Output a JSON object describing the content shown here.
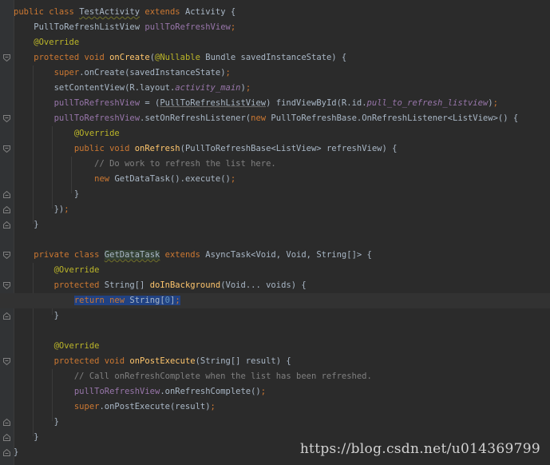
{
  "editor": {
    "language": "java",
    "current_line": 20
  },
  "lines": [
    {
      "line": 1,
      "segments": [
        {
          "t": "public class ",
          "c": "kw"
        },
        {
          "t": "TestActivity",
          "c": "plain warn"
        },
        {
          "t": " extends ",
          "c": "kw"
        },
        {
          "t": "Activity {",
          "c": "plain"
        }
      ]
    },
    {
      "line": 2,
      "segments": [
        {
          "t": "    PullToRefreshListView ",
          "c": "plain"
        },
        {
          "t": "pullToRefreshView",
          "c": "field"
        },
        {
          "t": ";",
          "c": "kw"
        }
      ]
    },
    {
      "line": 3,
      "segments": [
        {
          "t": "    @Override",
          "c": "ann"
        }
      ]
    },
    {
      "line": 4,
      "segments": [
        {
          "t": "    protected void ",
          "c": "kw"
        },
        {
          "t": "onCreate",
          "c": "fn"
        },
        {
          "t": "(",
          "c": "plain"
        },
        {
          "t": "@Nullable",
          "c": "ann"
        },
        {
          "t": " Bundle savedInstanceState) {",
          "c": "plain"
        }
      ]
    },
    {
      "line": 5,
      "segments": [
        {
          "t": "        ",
          "c": "plain"
        },
        {
          "t": "super",
          "c": "kw"
        },
        {
          "t": ".onCreate(savedInstanceState)",
          "c": "plain"
        },
        {
          "t": ";",
          "c": "kw"
        }
      ]
    },
    {
      "line": 6,
      "segments": [
        {
          "t": "        setContentView(R.layout.",
          "c": "plain"
        },
        {
          "t": "activity_main",
          "c": "fieldi"
        },
        {
          "t": ")",
          "c": "plain"
        },
        {
          "t": ";",
          "c": "kw"
        }
      ]
    },
    {
      "line": 7,
      "segments": [
        {
          "t": "        ",
          "c": "plain"
        },
        {
          "t": "pullToRefreshView",
          "c": "field"
        },
        {
          "t": " = (",
          "c": "plain"
        },
        {
          "t": "PullToRefreshListView",
          "c": "plain castbox"
        },
        {
          "t": ") findViewById(R.id.",
          "c": "plain"
        },
        {
          "t": "pull_to_refresh_listview",
          "c": "fieldi"
        },
        {
          "t": ")",
          "c": "plain"
        },
        {
          "t": ";",
          "c": "kw"
        }
      ]
    },
    {
      "line": 8,
      "segments": [
        {
          "t": "        ",
          "c": "plain"
        },
        {
          "t": "pullToRefreshView",
          "c": "field"
        },
        {
          "t": ".setOnRefreshListener(",
          "c": "plain"
        },
        {
          "t": "new ",
          "c": "kw"
        },
        {
          "t": "PullToRefreshBase.OnRefreshListener<ListView>() {",
          "c": "plain"
        }
      ]
    },
    {
      "line": 9,
      "segments": [
        {
          "t": "            @Override",
          "c": "ann"
        }
      ]
    },
    {
      "line": 10,
      "segments": [
        {
          "t": "            public void ",
          "c": "kw"
        },
        {
          "t": "onRefresh",
          "c": "fn"
        },
        {
          "t": "(PullToRefreshBase<ListView> refreshView) {",
          "c": "plain"
        }
      ]
    },
    {
      "line": 11,
      "segments": [
        {
          "t": "                // Do work to refresh the list here.",
          "c": "cmt"
        }
      ]
    },
    {
      "line": 12,
      "segments": [
        {
          "t": "                ",
          "c": "plain"
        },
        {
          "t": "new ",
          "c": "kw"
        },
        {
          "t": "GetDataTask().execute()",
          "c": "plain"
        },
        {
          "t": ";",
          "c": "kw"
        }
      ]
    },
    {
      "line": 13,
      "segments": [
        {
          "t": "            }",
          "c": "plain"
        }
      ]
    },
    {
      "line": 14,
      "segments": [
        {
          "t": "        })",
          "c": "plain"
        },
        {
          "t": ";",
          "c": "kw"
        }
      ]
    },
    {
      "line": 15,
      "segments": [
        {
          "t": "    }",
          "c": "plain"
        }
      ]
    },
    {
      "line": 16,
      "segments": []
    },
    {
      "line": 17,
      "segments": [
        {
          "t": "    private class ",
          "c": "kw"
        },
        {
          "t": "GetDataTask",
          "c": "plain hl-class warn"
        },
        {
          "t": " extends ",
          "c": "kw"
        },
        {
          "t": "AsyncTask<Void, Void, String[]> {",
          "c": "plain"
        }
      ]
    },
    {
      "line": 18,
      "segments": [
        {
          "t": "        @Override",
          "c": "ann"
        }
      ]
    },
    {
      "line": 19,
      "segments": [
        {
          "t": "        protected ",
          "c": "kw"
        },
        {
          "t": "String[] ",
          "c": "plain"
        },
        {
          "t": "doInBackground",
          "c": "fn"
        },
        {
          "t": "(Void... voids) {",
          "c": "plain"
        }
      ]
    },
    {
      "line": 20,
      "segments": [
        {
          "t": "            ",
          "c": "plain"
        },
        {
          "t": "return new ",
          "c": "kw hl-sel"
        },
        {
          "t": "String[",
          "c": "plain hl-sel"
        },
        {
          "t": "0",
          "c": "num hl-sel"
        },
        {
          "t": "]",
          "c": "plain hl-sel"
        },
        {
          "t": ";",
          "c": "kw hl-sel"
        }
      ]
    },
    {
      "line": 21,
      "segments": [
        {
          "t": "        }",
          "c": "plain"
        }
      ]
    },
    {
      "line": 22,
      "segments": []
    },
    {
      "line": 23,
      "segments": [
        {
          "t": "        @Override",
          "c": "ann"
        }
      ]
    },
    {
      "line": 24,
      "segments": [
        {
          "t": "        protected void ",
          "c": "kw"
        },
        {
          "t": "onPostExecute",
          "c": "fn"
        },
        {
          "t": "(String[] result) {",
          "c": "plain"
        }
      ]
    },
    {
      "line": 25,
      "segments": [
        {
          "t": "            // Call onRefreshComplete when the list has been refreshed.",
          "c": "cmt"
        }
      ]
    },
    {
      "line": 26,
      "segments": [
        {
          "t": "            ",
          "c": "plain"
        },
        {
          "t": "pullToRefreshView",
          "c": "field"
        },
        {
          "t": ".onRefreshComplete()",
          "c": "plain"
        },
        {
          "t": ";",
          "c": "kw"
        }
      ]
    },
    {
      "line": 27,
      "segments": [
        {
          "t": "            ",
          "c": "plain"
        },
        {
          "t": "super",
          "c": "kw"
        },
        {
          "t": ".onPostExecute(result)",
          "c": "plain"
        },
        {
          "t": ";",
          "c": "kw"
        }
      ]
    },
    {
      "line": 28,
      "segments": [
        {
          "t": "        }",
          "c": "plain"
        }
      ]
    },
    {
      "line": 29,
      "segments": [
        {
          "t": "    }",
          "c": "plain"
        }
      ]
    },
    {
      "line": 30,
      "segments": [
        {
          "t": "}",
          "c": "plain"
        }
      ]
    }
  ],
  "fold_markers": [
    {
      "line": 4,
      "kind": "open"
    },
    {
      "line": 8,
      "kind": "open"
    },
    {
      "line": 10,
      "kind": "open"
    },
    {
      "line": 13,
      "kind": "close"
    },
    {
      "line": 14,
      "kind": "close"
    },
    {
      "line": 15,
      "kind": "close"
    },
    {
      "line": 17,
      "kind": "open"
    },
    {
      "line": 19,
      "kind": "open"
    },
    {
      "line": 21,
      "kind": "close"
    },
    {
      "line": 24,
      "kind": "open"
    },
    {
      "line": 28,
      "kind": "close"
    },
    {
      "line": 29,
      "kind": "close"
    },
    {
      "line": 30,
      "kind": "close"
    }
  ],
  "watermark": "https://blog.csdn.net/u014369799"
}
